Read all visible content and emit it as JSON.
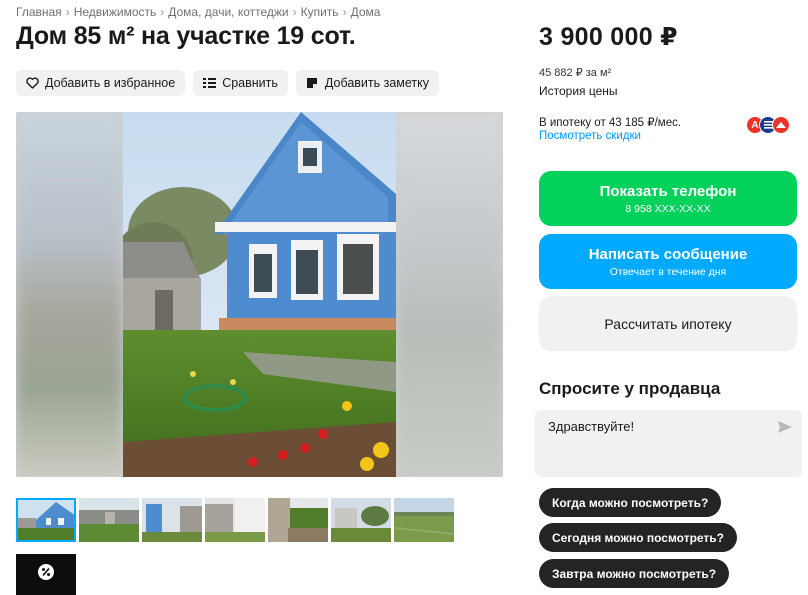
{
  "breadcrumb": [
    "Главная",
    "Недвижимость",
    "Дома, дачи, коттеджи",
    "Купить",
    "Дома"
  ],
  "title": "Дом 85 м² на участке 19 сот.",
  "actions": {
    "favorite": "Добавить в избранное",
    "compare": "Сравнить",
    "note": "Добавить заметку"
  },
  "gallery": {
    "thumbnails_count": 7,
    "active_thumbnail": 1
  },
  "price": {
    "value": "3 900 000 ₽",
    "per_m2": "45 882 ₽ за м²",
    "history_link": "История цены"
  },
  "mortgage": {
    "text": "В ипотеку от 43 185 ₽/мес.",
    "discounts_link": "Посмотреть скидки",
    "bank_icons": [
      "alfa-bank-icon",
      "bank-icon",
      "sovcombank-icon"
    ]
  },
  "buttons": {
    "phone_title": "Показать телефон",
    "phone_number": "8 958 XXX-XX-XX",
    "message_title": "Написать сообщение",
    "message_sub": "Отвечает в течение дня",
    "calc_title": "Рассчитать ипотеку"
  },
  "ask": {
    "title": "Спросите у продавца",
    "message_value": "Здравствуйте!",
    "chips": [
      "Когда можно посмотреть?",
      "Сегодня можно посмотреть?",
      "Завтра можно посмотреть?"
    ]
  },
  "colors": {
    "green": "#02d15c",
    "blue": "#00aaff",
    "link": "#0099f7",
    "chip": "#242424"
  }
}
